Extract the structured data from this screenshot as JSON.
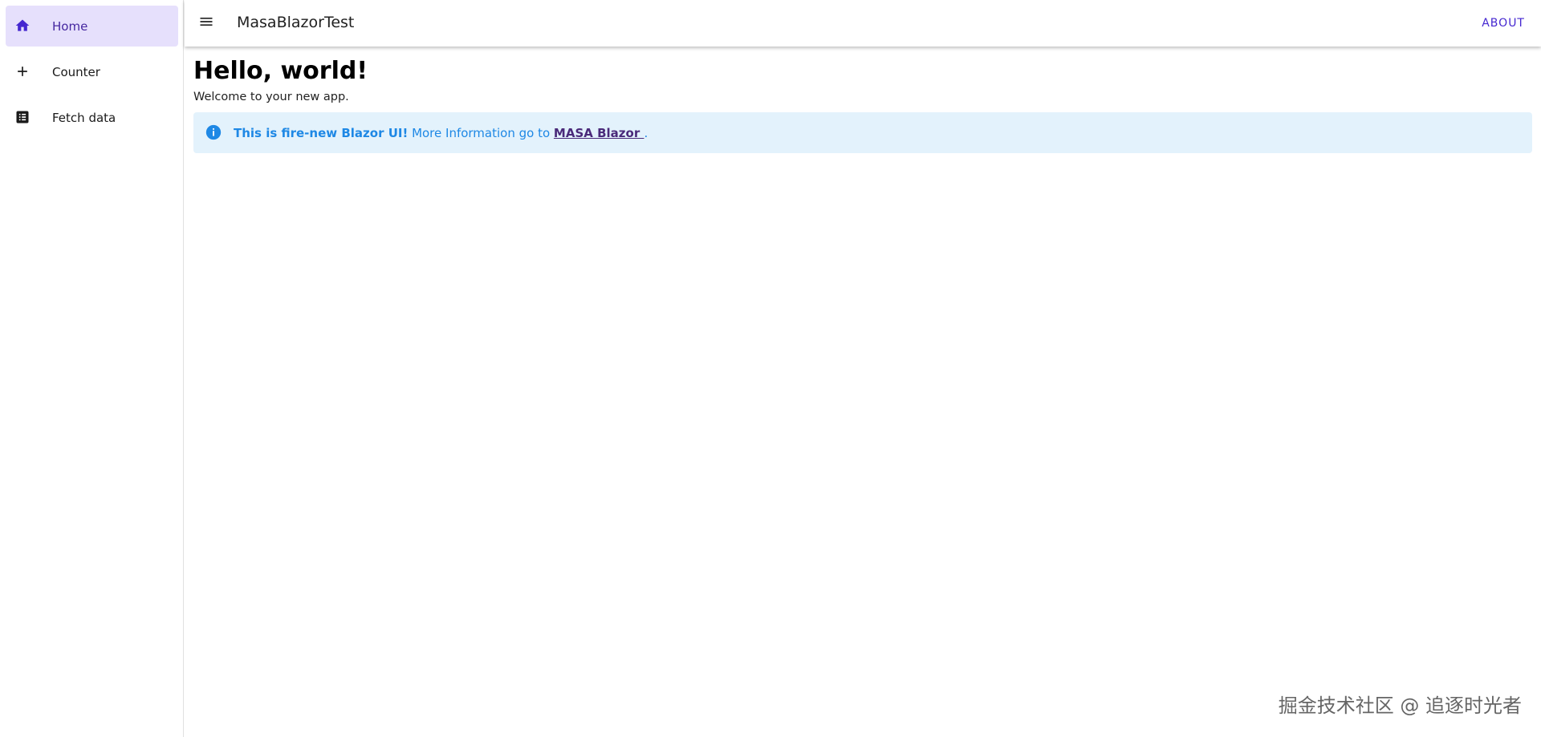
{
  "app": {
    "title": "MasaBlazorTest",
    "about_label": "ABOUT"
  },
  "sidebar": {
    "items": [
      {
        "label": "Home",
        "icon": "home-icon",
        "active": true
      },
      {
        "label": "Counter",
        "icon": "plus-icon",
        "active": false
      },
      {
        "label": "Fetch data",
        "icon": "list-box-icon",
        "active": false
      }
    ]
  },
  "main": {
    "heading": "Hello, world!",
    "subtext": "Welcome to your new app.",
    "alert": {
      "icon": "info-icon",
      "bold_text": "This is fire-new Blazor UI!",
      "text": " More Information go to ",
      "link_text": "MASA Blazor ",
      "suffix": "."
    }
  },
  "watermark": "掘金技术社区 @ 追逐时光者",
  "colors": {
    "accent": "#4527d0",
    "active_nav_bg": "#e6e0fc",
    "alert_bg": "#e3f2fc",
    "alert_text": "#1e88e5",
    "link": "#4a2a7a"
  }
}
